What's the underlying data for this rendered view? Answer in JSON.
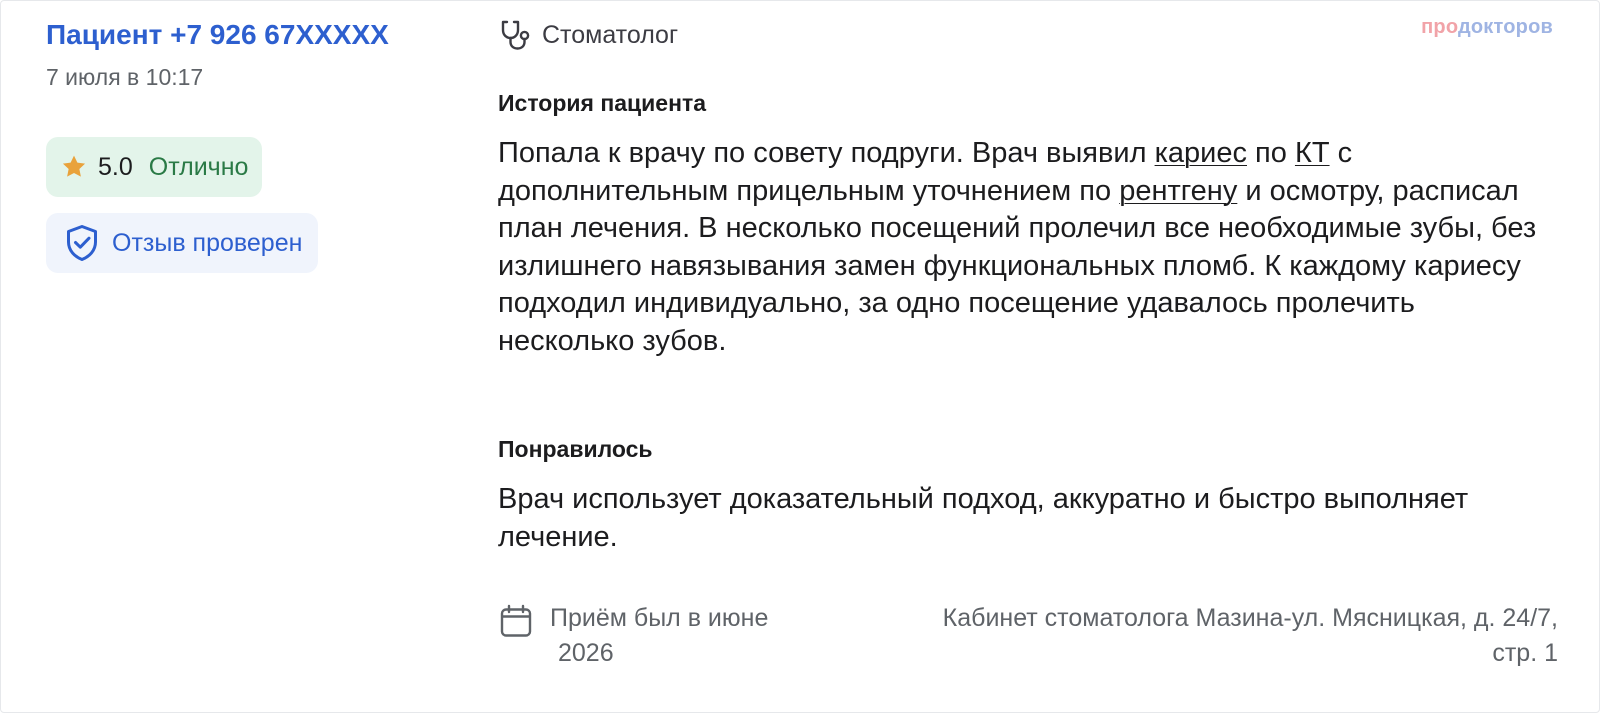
{
  "patient": {
    "name": "Пациент +7 926 67XXXXX",
    "date": "7 июля в 10:17"
  },
  "rating": {
    "value": "5.0",
    "label": "Отлично",
    "stars_icon": "star-icon",
    "color": "#e9a23b"
  },
  "verification": {
    "label": "Отзыв проверен",
    "icon": "shield-check-icon"
  },
  "specialty": {
    "icon": "stethoscope-icon",
    "label": "Стоматолог"
  },
  "brand": {
    "part1": "про",
    "part2": "докторов"
  },
  "history": {
    "title": "История пациента",
    "t1": "Попала к врачу по совету подруги. Врач выявил ",
    "link1": "кариес",
    "t2": " по ",
    "link2": "КТ",
    "t3": " с дополнительным прицельным уточнением по ",
    "link3": "рентгену",
    "t4": " и осмотру, расписал план лечения. В несколько посещений пролечил все необходимые зубы, без излишнего навязывания замен функциональных пломб. К каждому кариесу подходил индивидуально, за одно посещение удавалось пролечить несколько зубов."
  },
  "liked": {
    "title": "Понравилось",
    "text": "Врач использует доказательный подход, аккуратно и быстро выполняет лечение."
  },
  "visit": {
    "icon": "calendar-icon",
    "line1": "Приём был в июне",
    "line2": "2026"
  },
  "clinic": {
    "text": "Кабинет стоматолога Мазина-ул. Мясницкая, д. 24/7, стр. 1"
  },
  "colors": {
    "accent": "#2d5fcf",
    "rating_bg": "#e3f4ea",
    "rating_text": "#2a7a46",
    "verified_bg": "#f0f4fc"
  }
}
